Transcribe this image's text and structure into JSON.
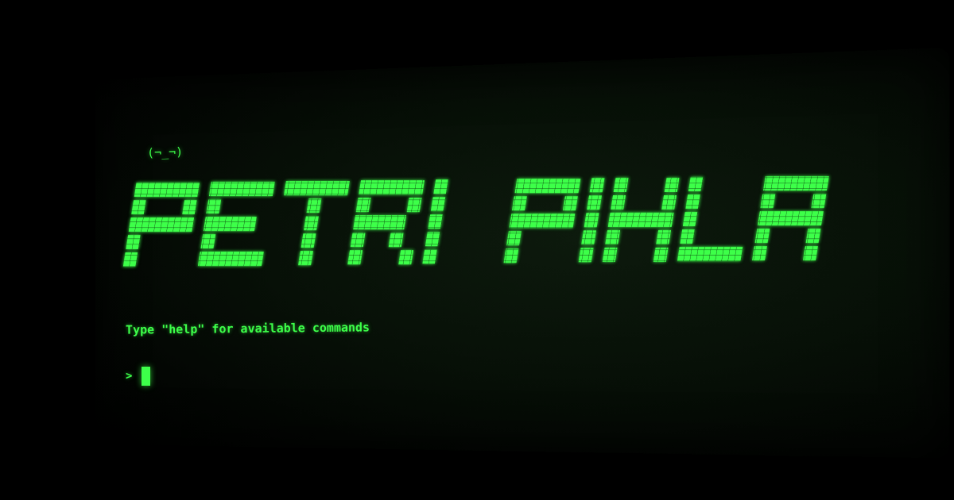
{
  "terminal": {
    "kaomoji": "(¬_¬)",
    "banner_text": "PETRI PIHLA",
    "hint": "Type \"help\" for available commands",
    "prompt_symbol": ">",
    "input_value": ""
  },
  "colors": {
    "phosphor_green": "#3dff4a",
    "background": "#000000"
  }
}
